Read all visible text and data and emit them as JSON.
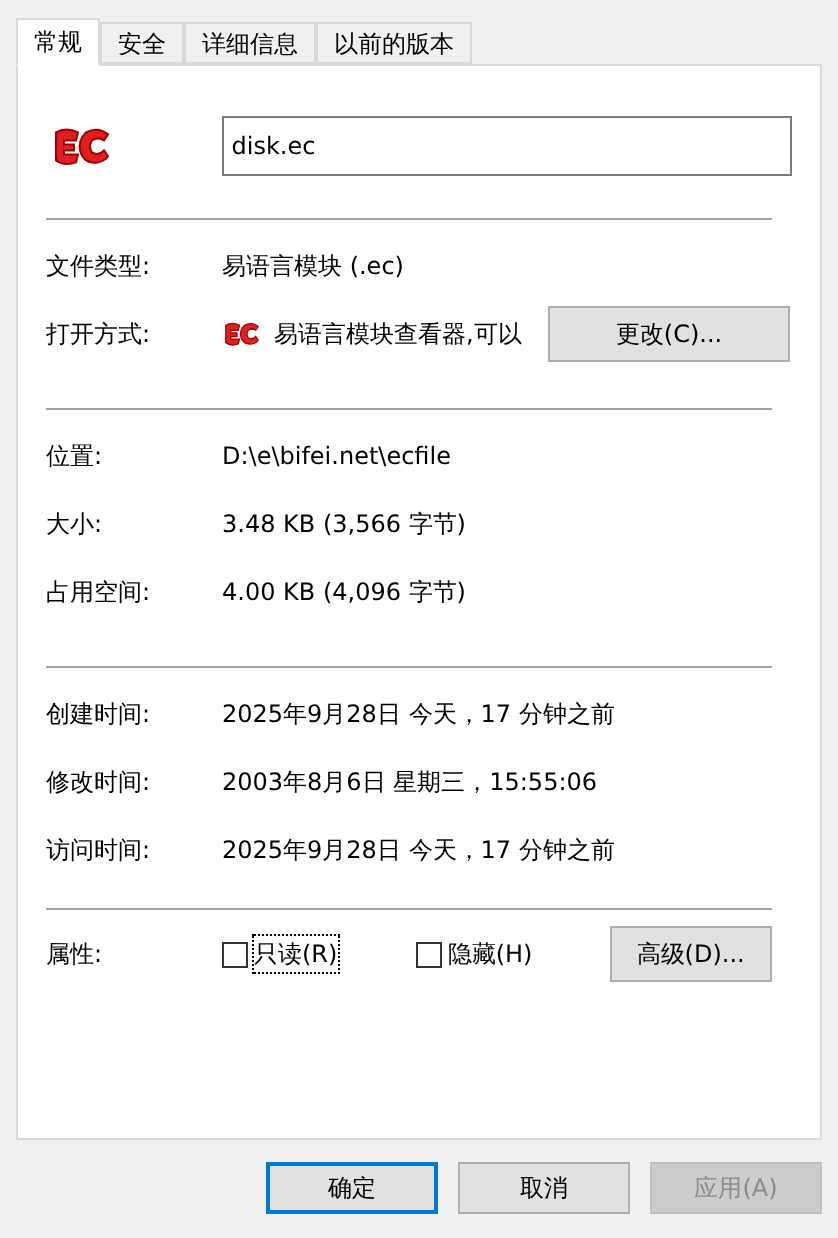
{
  "tabs": [
    {
      "label": "常规",
      "selected": true
    },
    {
      "label": "安全",
      "selected": false
    },
    {
      "label": "详细信息",
      "selected": false
    },
    {
      "label": "以前的版本",
      "selected": false
    }
  ],
  "file_name": {
    "value": "disk.ec"
  },
  "groups": [
    [
      {
        "label": "文件类型:",
        "value": "易语言模块 (.ec)"
      },
      {
        "label": "打开方式:",
        "value": "易语言模块查看器,可以",
        "kind": "opener",
        "button": "更改(C)..."
      }
    ],
    [
      {
        "label": "位置:",
        "value": "D:\\e\\bifei.net\\ecfile"
      },
      {
        "label": "大小:",
        "value": "3.48 KB (3,566 字节)"
      },
      {
        "label": "占用空间:",
        "value": "4.00 KB (4,096 字节)"
      }
    ],
    [
      {
        "label": "创建时间:",
        "value": "2025年9月28日 今天，17 分钟之前"
      },
      {
        "label": "修改时间:",
        "value": "2003年8月6日 星期三，15:55:06"
      },
      {
        "label": "访问时间:",
        "value": "2025年9月28日 今天，17 分钟之前"
      }
    ]
  ],
  "attributes": {
    "label": "属性:",
    "checkboxes": [
      {
        "label": "只读(R)",
        "checked": false,
        "focused": true
      },
      {
        "label": "隐藏(H)",
        "checked": false,
        "focused": false
      }
    ],
    "button": "高级(D)..."
  },
  "buttons": [
    {
      "label": "确定",
      "default": true,
      "disabled": false
    },
    {
      "label": "取消",
      "default": false,
      "disabled": false
    },
    {
      "label": "应用(A)",
      "default": false,
      "disabled": true
    }
  ]
}
